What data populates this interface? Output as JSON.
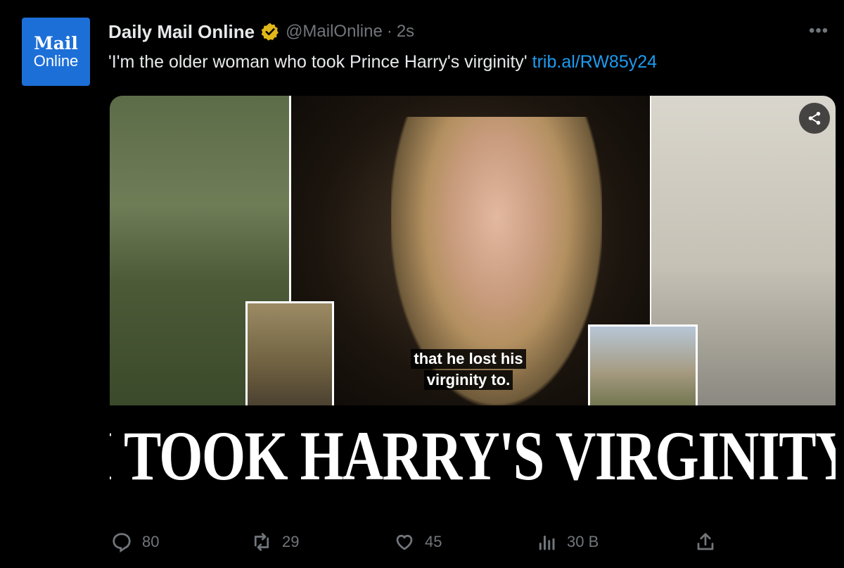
{
  "avatar": {
    "line1": "Mail",
    "line2": "Online"
  },
  "header": {
    "name": "Daily Mail Online",
    "handle": "@MailOnline",
    "separator": "·",
    "time": "2s",
    "more": "•••"
  },
  "tweet": {
    "text": "'I'm the older woman who took Prince Harry's virginity'",
    "link": "trib.al/RW85y24"
  },
  "media": {
    "caption_line1": "that he lost his",
    "caption_line2": "virginity to.",
    "headline": "'I TOOK HARRY'S VIRGINITY'"
  },
  "actions": {
    "replies": "80",
    "reposts": "29",
    "likes": "45",
    "views": "30 B"
  },
  "colors": {
    "background": "#000000",
    "link": "#1d9bf0",
    "verified": "#e2b719",
    "avatar": "#1d6fd8",
    "muted": "#71767b"
  },
  "icons": [
    "verified-badge-icon",
    "more-icon",
    "share-icon",
    "reply-icon",
    "repost-icon",
    "like-icon",
    "views-icon",
    "upload-icon"
  ]
}
